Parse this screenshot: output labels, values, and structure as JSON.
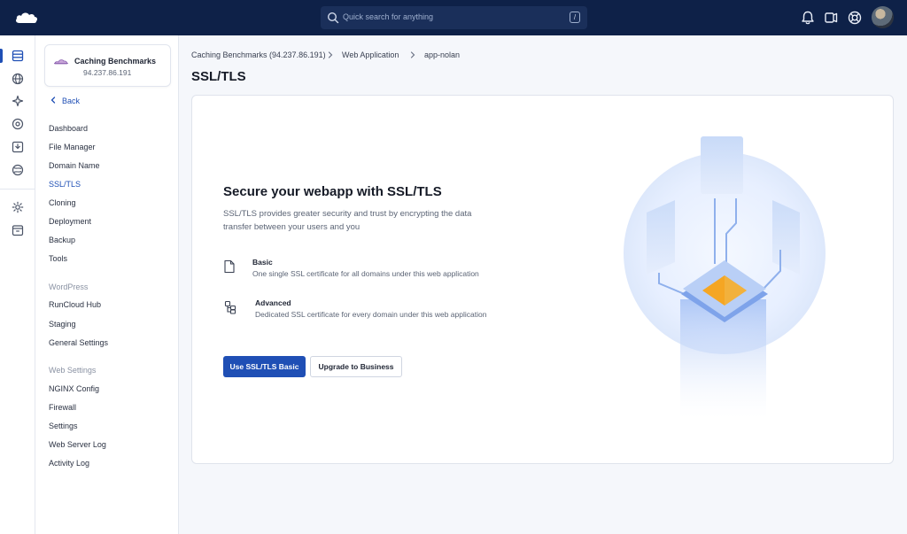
{
  "header": {
    "search": {
      "placeholder": "Quick search for anything",
      "shortcut": "/"
    }
  },
  "server_card": {
    "name": "Caching Benchmarks",
    "ip": "94.237.86.191"
  },
  "sidebar": {
    "back_label": "Back",
    "items": [
      {
        "label": "Dashboard"
      },
      {
        "label": "File Manager"
      },
      {
        "label": "Domain Name"
      },
      {
        "label": "SSL/TLS",
        "active": true
      },
      {
        "label": "Cloning"
      },
      {
        "label": "Deployment"
      },
      {
        "label": "Backup"
      },
      {
        "label": "Tools"
      }
    ],
    "wordpress_section": "WordPress",
    "wordpress_items": [
      {
        "label": "RunCloud Hub"
      },
      {
        "label": "Staging"
      },
      {
        "label": "General Settings"
      }
    ],
    "web_settings_section": "Web Settings",
    "web_settings_items": [
      {
        "label": "NGINX Config"
      },
      {
        "label": "Firewall"
      },
      {
        "label": "Settings"
      },
      {
        "label": "Web Server Log"
      },
      {
        "label": "Activity Log"
      }
    ]
  },
  "breadcrumb": [
    "Caching Benchmarks (94.237.86.191)",
    "Web Application",
    "app-nolan"
  ],
  "page_title": "SSL/TLS",
  "content": {
    "headline": "Secure your webapp with SSL/TLS",
    "description": "SSL/TLS provides greater security and trust by encrypting the data transfer between your users and you",
    "options": [
      {
        "title": "Basic",
        "description": "One single SSL certificate for all domains under this web application",
        "icon": "document-icon"
      },
      {
        "title": "Advanced",
        "description": "Dedicated SSL certificate for every domain under this web application",
        "icon": "multi-domain-icon"
      }
    ],
    "primary_button": "Use SSL/TLS Basic",
    "secondary_button": "Upgrade to Business"
  },
  "colors": {
    "topbar": "#0e2148",
    "accent": "#1f4fb5",
    "illustration_orange": "#f5a623"
  }
}
